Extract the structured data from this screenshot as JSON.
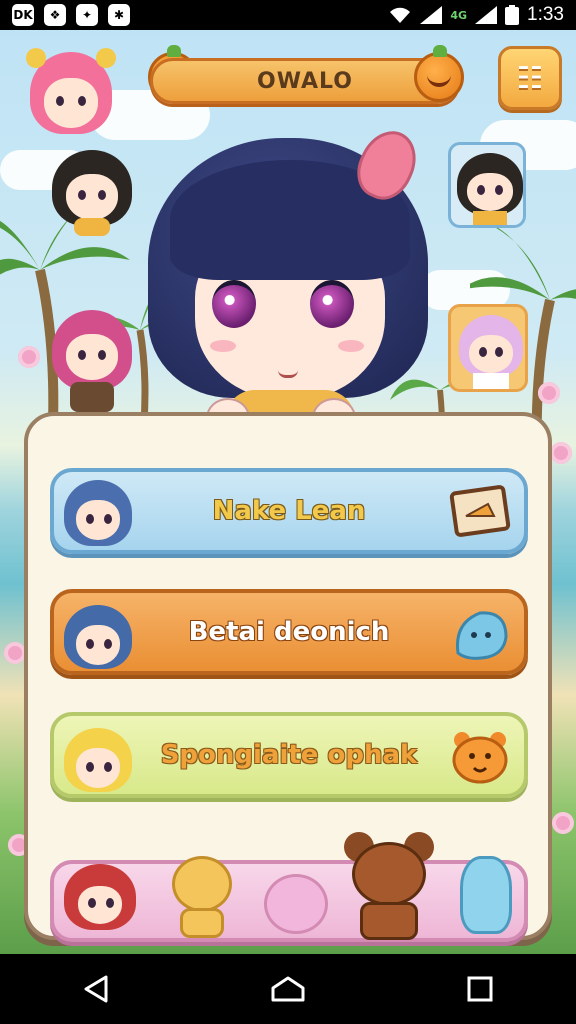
{
  "status_bar": {
    "left_icons": [
      "notification-icon-1",
      "notification-icon-2",
      "notification-icon-3",
      "notification-icon-4"
    ],
    "badge_texts": [
      "DK",
      "❖",
      "✦",
      "✱"
    ],
    "network_label": "4G",
    "time": "1:33"
  },
  "header": {
    "title": "OWALO",
    "menu_label": "☷"
  },
  "menu": {
    "items": [
      {
        "label": "Nake Lean",
        "icon": "map-icon"
      },
      {
        "label": "Betai deonich",
        "icon": "blue-ghost-icon"
      },
      {
        "label": "Spongiaite ophak",
        "icon": "orange-bear-icon"
      }
    ]
  },
  "colors": {
    "accent_orange": "#ee9f3c",
    "panel_bg": "#fbf5e6",
    "row1": "#a6d4ee",
    "row2": "#ea8f34",
    "row3": "#d8e98a",
    "row4": "#eeb6d6"
  },
  "nav": {
    "back_icon": "back-triangle-icon",
    "home_icon": "home-icon",
    "recent_icon": "recent-apps-icon"
  }
}
